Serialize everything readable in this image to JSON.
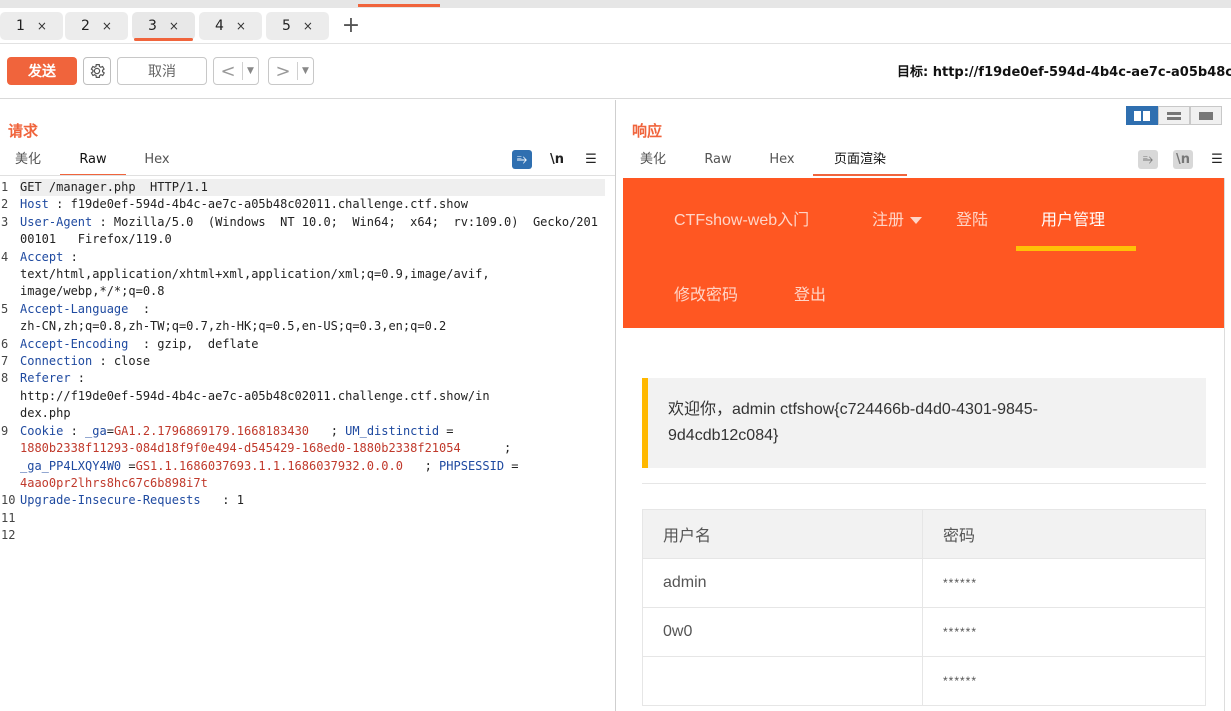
{
  "tabs": [
    {
      "label": "1",
      "close": "×"
    },
    {
      "label": "2",
      "close": "×"
    },
    {
      "label": "3",
      "close": "×"
    },
    {
      "label": "4",
      "close": "×"
    },
    {
      "label": "5",
      "close": "×"
    }
  ],
  "tab_add": "+",
  "toolbar": {
    "send_label": "发送",
    "settings_icon": "gear-icon",
    "cancel_label": "取消",
    "back_glyph": "<",
    "forward_glyph": ">",
    "dropdown_glyph": "▼",
    "target": "目标: http://f19de0ef-594d-4b4c-ae7c-a05b48c"
  },
  "request": {
    "title": "请求",
    "subtabs": [
      "美化",
      "Raw",
      "Hex"
    ],
    "active_subtab": "Raw",
    "icons": {
      "wrap": "⥱",
      "newline": "\\n",
      "menu": "☰"
    },
    "lines": [
      {
        "num": "1",
        "key": "",
        "text": "GET /manager.php  HTTP/1.1"
      },
      {
        "num": "2",
        "key": "Host",
        "text": " : f19de0ef-594d-4b4c-ae7c-a05b48c02011.challenge.ctf.show"
      },
      {
        "num": "3",
        "key": "User-Agent",
        "text": " : Mozilla/5.0  (Windows  NT 10.0;  Win64;  x64;  rv:109.0)  Gecko/20100101   Firefox/119.0"
      },
      {
        "num": "4",
        "key": "Accept",
        "text": " :\ntext/html,application/xhtml+xml,application/xml;q=0.9,image/avif,\nimage/webp,*/*;q=0.8"
      },
      {
        "num": "5",
        "key": "Accept-Language",
        "text": "  :\nzh-CN,zh;q=0.8,zh-TW;q=0.7,zh-HK;q=0.5,en-US;q=0.3,en;q=0.2"
      },
      {
        "num": "6",
        "key": "Accept-Encoding",
        "text": "  : gzip,  deflate"
      },
      {
        "num": "7",
        "key": "Connection",
        "text": " : close"
      },
      {
        "num": "8",
        "key": "Referer",
        "text": " :\nhttp://f19de0ef-594d-4b4c-ae7c-a05b48c02011.challenge.ctf.show/in\ndex.php"
      },
      {
        "num": "9",
        "key": "Cookie",
        "text": ""
      },
      {
        "num": "10",
        "key": "Upgrade-Insecure-Requests",
        "text": "   : 1"
      },
      {
        "num": "11",
        "key": "",
        "text": ""
      },
      {
        "num": "12",
        "key": "",
        "text": ""
      }
    ],
    "cookie": {
      "k1": " _ga",
      "v1": "GA1.2.1796869179.1668183430",
      "k2": "UM_distinctid",
      "v2": "1880b2338f11293-084d18f9f0e494-d545429-168ed0-1880b2338f21054",
      "k3": "_ga_PP4LXQY4W0",
      "v3": "GS1.1.1686037693.1.1.1686037932.0.0.0",
      "k4": "PHPSESSID",
      "v4": "4aao0pr2lhrs8hc67c6b898i7t"
    }
  },
  "response": {
    "title": "响应",
    "subtabs": [
      "美化",
      "Raw",
      "Hex",
      "页面渲染"
    ],
    "active_subtab": "页面渲染",
    "icons": {
      "wrap": "⥱",
      "newline": "\\n",
      "menu": "☰"
    },
    "page": {
      "brand": "CTFshow-web入门",
      "nav": [
        "注册",
        "登陆",
        "用户管理",
        "修改密码",
        "登出"
      ],
      "active_nav": "用户管理",
      "welcome": "欢迎你，admin ctfshow{c724466b-d4d0-4301-9845-9d4cdb12c084}",
      "table": {
        "headers": [
          "用户名",
          "密码"
        ],
        "rows": [
          [
            "admin",
            "******"
          ],
          [
            "0w0",
            "******"
          ],
          [
            "",
            "******"
          ]
        ]
      }
    }
  },
  "colors": {
    "accent": "#f0643c",
    "nav_bg": "#ff5722",
    "nav_underline": "#ffc107",
    "quote_border": "#ffb800",
    "active_icon": "#2f6fb0"
  }
}
